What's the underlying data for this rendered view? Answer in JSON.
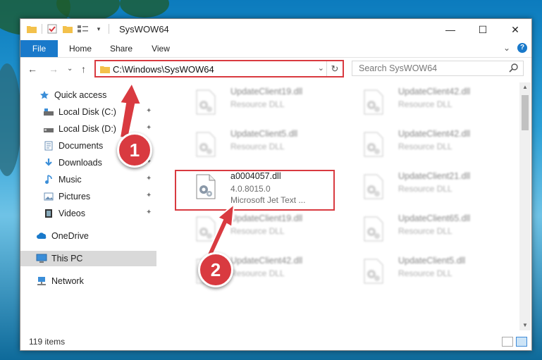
{
  "window": {
    "title": "SysWOW64",
    "controls": {
      "minimize": "—",
      "maximize": "☐",
      "close": "✕"
    }
  },
  "ribbon": {
    "tabs": [
      "File",
      "Home",
      "Share",
      "View"
    ],
    "help": "?",
    "expand": "⌄"
  },
  "nav": {
    "back": "←",
    "forward": "→",
    "recent": "⌄",
    "up": "↑",
    "address": "C:\\Windows\\SysWOW64",
    "dropdown": "⌄",
    "refresh": "↻",
    "search_placeholder": "Search SysWOW64"
  },
  "sidebar": {
    "items": [
      {
        "label": "Quick access",
        "icon": "star-icon"
      },
      {
        "label": "Local Disk (C:)",
        "icon": "drive-icon",
        "pinned": true
      },
      {
        "label": "Local Disk (D:)",
        "icon": "drive-icon",
        "pinned": true
      },
      {
        "label": "Documents",
        "icon": "document-icon",
        "pinned": true
      },
      {
        "label": "Downloads",
        "icon": "download-icon",
        "pinned": true
      },
      {
        "label": "Music",
        "icon": "music-icon",
        "pinned": true
      },
      {
        "label": "Pictures",
        "icon": "picture-icon",
        "pinned": true
      },
      {
        "label": "Videos",
        "icon": "video-icon",
        "pinned": true
      },
      {
        "label": "OneDrive",
        "icon": "cloud-icon"
      },
      {
        "label": "This PC",
        "icon": "computer-icon",
        "selected": true
      },
      {
        "label": "Network",
        "icon": "network-icon"
      }
    ],
    "pin_glyph": "📌"
  },
  "files": [
    {
      "name": "UpdateClient19.dll",
      "line2": "Resource DLL",
      "line3": "",
      "blurred": true
    },
    {
      "name": "UpdateClient42.dll",
      "line2": "Resource DLL",
      "line3": "",
      "blurred": true
    },
    {
      "name": "UpdateClient5.dll",
      "line2": "Resource DLL",
      "line3": "",
      "blurred": true
    },
    {
      "name": "UpdateClient42.dll",
      "line2": "Resource DLL",
      "line3": "",
      "blurred": true
    },
    {
      "name": "a0004057.dll",
      "line2": "4.0.8015.0",
      "line3": "Microsoft Jet Text ...",
      "blurred": false,
      "highlighted": true
    },
    {
      "name": "UpdateClient21.dll",
      "line2": "Resource DLL",
      "line3": "",
      "blurred": true
    },
    {
      "name": "UpdateClient19.dll",
      "line2": "Resource DLL",
      "line3": "",
      "blurred": true
    },
    {
      "name": "UpdateClient65.dll",
      "line2": "Resource DLL",
      "line3": "",
      "blurred": true
    },
    {
      "name": "UpdateClient42.dll",
      "line2": "Resource DLL",
      "line3": "",
      "blurred": true
    },
    {
      "name": "UpdateClient5.dll",
      "line2": "Resource DLL",
      "line3": "",
      "blurred": true
    }
  ],
  "status": {
    "item_count": "119 items"
  },
  "callouts": {
    "step1": "1",
    "step2": "2"
  },
  "colors": {
    "accent": "#1979ca",
    "highlight": "#d93a40",
    "selected_bg": "#d9d9d9"
  }
}
